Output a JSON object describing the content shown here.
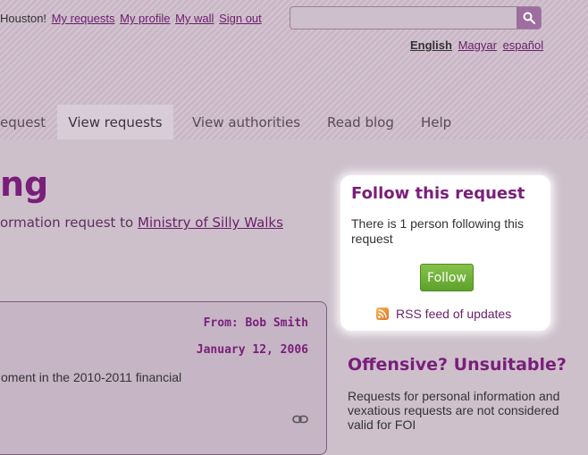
{
  "header": {
    "greeting": "Houston!",
    "user_links": [
      "My requests",
      "My profile",
      "My wall",
      "Sign out"
    ],
    "search": {
      "value": "",
      "placeholder": ""
    },
    "languages": [
      {
        "label": "English",
        "current": true
      },
      {
        "label": "Magyar",
        "current": false
      },
      {
        "label": "español",
        "current": false
      }
    ]
  },
  "nav": {
    "tabs": [
      {
        "label": "equest",
        "active": false
      },
      {
        "label": "View requests",
        "active": true
      },
      {
        "label": "View authorities",
        "active": false
      },
      {
        "label": "Read blog",
        "active": false
      },
      {
        "label": "Help",
        "active": false
      }
    ]
  },
  "page": {
    "title": "ng",
    "subtitle_prefix": "ormation request to",
    "authority_link": "Ministry of Silly Walks"
  },
  "correspondence": {
    "from": "From: Bob Smith",
    "date": "January 12, 2006",
    "body": "oment in the 2010-2011 financial"
  },
  "sidebar": {
    "follow": {
      "title": "Follow this request",
      "text": "There is 1 person following this request",
      "button": "Follow",
      "rss": "RSS feed of updates"
    },
    "offensive": {
      "title": "Offensive? Unsuitable?",
      "text": "Requests for personal information and vexatious requests are not considered valid for FOI"
    }
  },
  "icons": {
    "search": "search-icon",
    "rss": "rss-icon",
    "link": "link-icon"
  },
  "colors": {
    "accent": "#7a1e7a",
    "link": "#6b1f6b",
    "follow_button": "#6fb23a",
    "search_button": "#9d6e9f"
  }
}
